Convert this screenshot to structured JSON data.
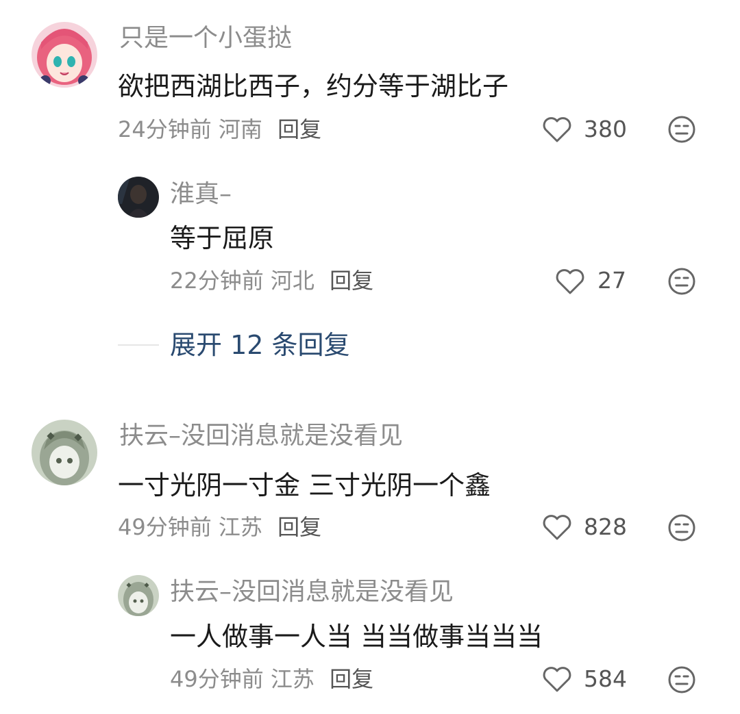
{
  "comments": [
    {
      "username": "只是一个小蛋挞",
      "text": "欲把西湖比西子，约分等于湖比子",
      "time": "24分钟前",
      "location": "河南",
      "reply_label": "回复",
      "likes": "380",
      "replies": [
        {
          "username": "淮真–",
          "text": "等于屈原",
          "time": "22分钟前",
          "location": "河北",
          "reply_label": "回复",
          "likes": "27"
        }
      ],
      "expand_label": "展开 12 条回复"
    },
    {
      "username": "扶云–没回消息就是没看见",
      "text": "一寸光阴一寸金 三寸光阴一个鑫",
      "time": "49分钟前",
      "location": "江苏",
      "reply_label": "回复",
      "likes": "828",
      "replies": [
        {
          "username": "扶云–没回消息就是没看见",
          "text": "一人做事一人当 当当做事当当当",
          "time": "49分钟前",
          "location": "江苏",
          "reply_label": "回复",
          "likes": "584"
        }
      ]
    }
  ],
  "icons": {
    "like": "heart-outline-icon",
    "dislike": "meh-face-icon"
  },
  "colors": {
    "name": "#8c8c8c",
    "text": "#1a1a1a",
    "meta": "#8c8c8c",
    "expand": "#2a4a70"
  }
}
